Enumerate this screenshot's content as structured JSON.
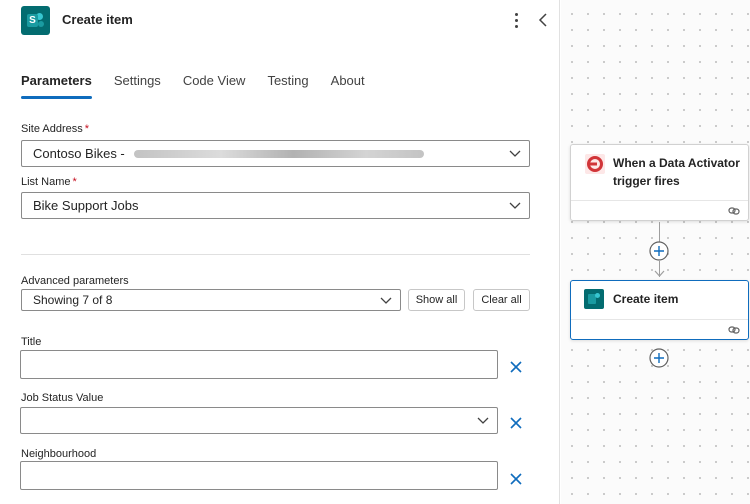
{
  "panel": {
    "title": "Create item",
    "tabs": [
      {
        "label": "Parameters",
        "active": true
      },
      {
        "label": "Settings",
        "active": false
      },
      {
        "label": "Code View",
        "active": false
      },
      {
        "label": "Testing",
        "active": false
      },
      {
        "label": "About",
        "active": false
      }
    ],
    "site_address": {
      "label": "Site Address",
      "required_mark": "*",
      "value": "Contoso Bikes - "
    },
    "list_name": {
      "label": "List Name",
      "required_mark": "*",
      "value": "Bike Support Jobs"
    },
    "advanced": {
      "label": "Advanced parameters",
      "value": "Showing 7 of 8",
      "show_all": "Show all",
      "clear_all": "Clear all"
    },
    "fields": [
      {
        "label": "Title",
        "value": ""
      },
      {
        "label": "Job Status Value",
        "value": ""
      },
      {
        "label": "Neighbourhood",
        "value": ""
      }
    ]
  },
  "canvas": {
    "trigger_card": {
      "title_line1": "When a Data Activator",
      "title_line2": "trigger fires"
    },
    "action_card": {
      "title": "Create item"
    }
  },
  "colors": {
    "accent": "#0f6cbd",
    "sharepoint": "#036c70",
    "required": "#c50f1f",
    "trigger": "#d13438"
  }
}
